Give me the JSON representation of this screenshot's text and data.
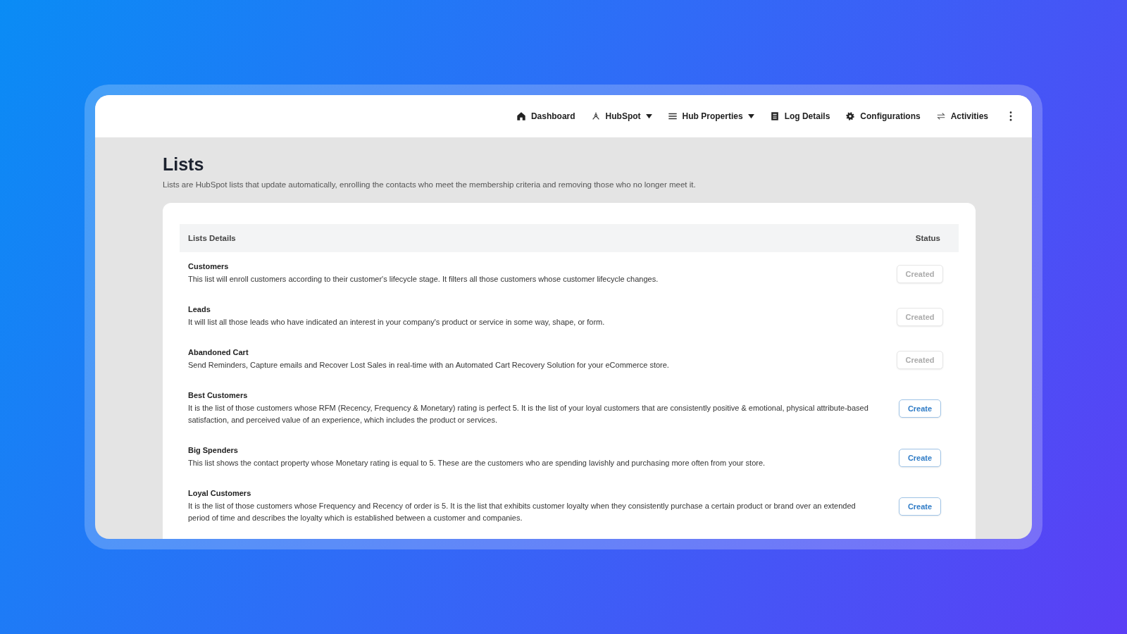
{
  "nav": {
    "items": [
      {
        "label": "Dashboard",
        "dropdown": false
      },
      {
        "label": "HubSpot",
        "dropdown": true
      },
      {
        "label": "Hub Properties",
        "dropdown": true
      },
      {
        "label": "Log Details",
        "dropdown": false
      },
      {
        "label": "Configurations",
        "dropdown": false
      },
      {
        "label": "Activities",
        "dropdown": false
      }
    ]
  },
  "page": {
    "title": "Lists",
    "description": "Lists are HubSpot lists that update automatically, enrolling the contacts who meet the membership criteria and removing those who no longer meet it."
  },
  "table": {
    "columns": [
      "Lists Details",
      "Status"
    ],
    "rows": [
      {
        "name": "Customers",
        "description": "This list will enroll customers according to their customer's lifecycle stage. It filters all those customers whose customer lifecycle changes.",
        "status": "Created",
        "disabled": true
      },
      {
        "name": "Leads",
        "description": "It will list all those leads who have indicated an interest in your company's product or service in some way, shape, or form.",
        "status": "Created",
        "disabled": true
      },
      {
        "name": "Abandoned Cart",
        "description": "Send Reminders, Capture emails and Recover Lost Sales in real-time with an Automated Cart Recovery Solution for your eCommerce store.",
        "status": "Created",
        "disabled": true
      },
      {
        "name": "Best Customers",
        "description": "It is the list of those customers whose RFM (Recency, Frequency & Monetary) rating is perfect 5. It is the list of your loyal customers that are consistently positive & emotional, physical attribute-based satisfaction, and perceived value of an experience, which includes the product or services.",
        "status": "Create",
        "disabled": false
      },
      {
        "name": "Big Spenders",
        "description": "This list shows the contact property whose Monetary rating is equal to 5. These are the customers who are spending lavishly and purchasing more often from your store.",
        "status": "Create",
        "disabled": false
      },
      {
        "name": "Loyal Customers",
        "description": "It is the list of those customers whose Frequency and Recency of order is 5. It is the list that exhibits customer loyalty when they consistently purchase a certain product or brand over an extended period of time and describes the loyalty which is established between a customer and companies.",
        "status": "Create",
        "disabled": false
      }
    ]
  }
}
